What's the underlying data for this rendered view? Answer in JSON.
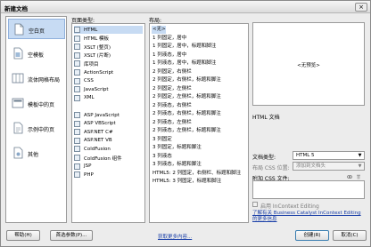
{
  "window": {
    "title": "新建文档",
    "close_label": "×"
  },
  "categories": [
    {
      "label": "空白页",
      "icon": "blank-page-icon",
      "selected": true
    },
    {
      "label": "空模板",
      "icon": "blank-template-icon",
      "selected": false
    },
    {
      "label": "流体网格布局",
      "icon": "fluid-grid-icon",
      "selected": false
    },
    {
      "label": "模板中的页",
      "icon": "template-page-icon",
      "selected": false
    },
    {
      "label": "示例中的页",
      "icon": "sample-page-icon",
      "selected": false
    },
    {
      "label": "其他",
      "icon": "other-icon",
      "selected": false
    }
  ],
  "page_types": {
    "header": "页面类型:",
    "items": [
      "HTML",
      "HTML 模板",
      "XSLT (整页)",
      "XSLT (片断)",
      "库项目",
      "ActionScript",
      "CSS",
      "JavaScript",
      "XML",
      "",
      "ASP JavaScript",
      "ASP VBScript",
      "ASP.NET C#",
      "ASP.NET VB",
      "ColdFusion",
      "ColdFusion 组件",
      "JSP",
      "PHP"
    ]
  },
  "layouts": {
    "header": "布局:",
    "items": [
      "<无>",
      "1 列固定，居中",
      "1 列固定，居中，标题和脚注",
      "1 列液态，居中",
      "1 列液态，居中，标题和脚注",
      "2 列固定，右侧栏",
      "2 列固定，右侧栏，标题和脚注",
      "2 列固定，左侧栏",
      "2 列固定，左侧栏，标题和脚注",
      "2 列液态，右侧栏",
      "2 列液态，右侧栏，标题和脚注",
      "2 列液态，左侧栏",
      "2 列液态，左侧栏，标题和脚注",
      "3 列固定",
      "3 列固定，标题和脚注",
      "3 列液态",
      "3 列液态，标题和脚注",
      "HTML5: 2 列固定，右侧栏、标题和脚注",
      "HTML5: 3 列固定，标题和脚注"
    ]
  },
  "preview": {
    "placeholder": "<无预览>",
    "caption": "HTML 文档"
  },
  "doctype": {
    "label": "文档类型:",
    "value": "HTML 5"
  },
  "layout_css": {
    "label": "布局 CSS 位置:",
    "value": "添加到文档头"
  },
  "attach_css": {
    "label": "附加 CSS 文件:"
  },
  "incontext": {
    "label": "启用 InContext Editing"
  },
  "learn_link": "了解有关 Business Catalyst InContext Editing 的更多信息",
  "footer": {
    "help": "帮助(H)",
    "prefs": "首选参数(P)...",
    "more_content": "获取更多内容...",
    "create": "创建(R)",
    "cancel": "取消(C)"
  }
}
